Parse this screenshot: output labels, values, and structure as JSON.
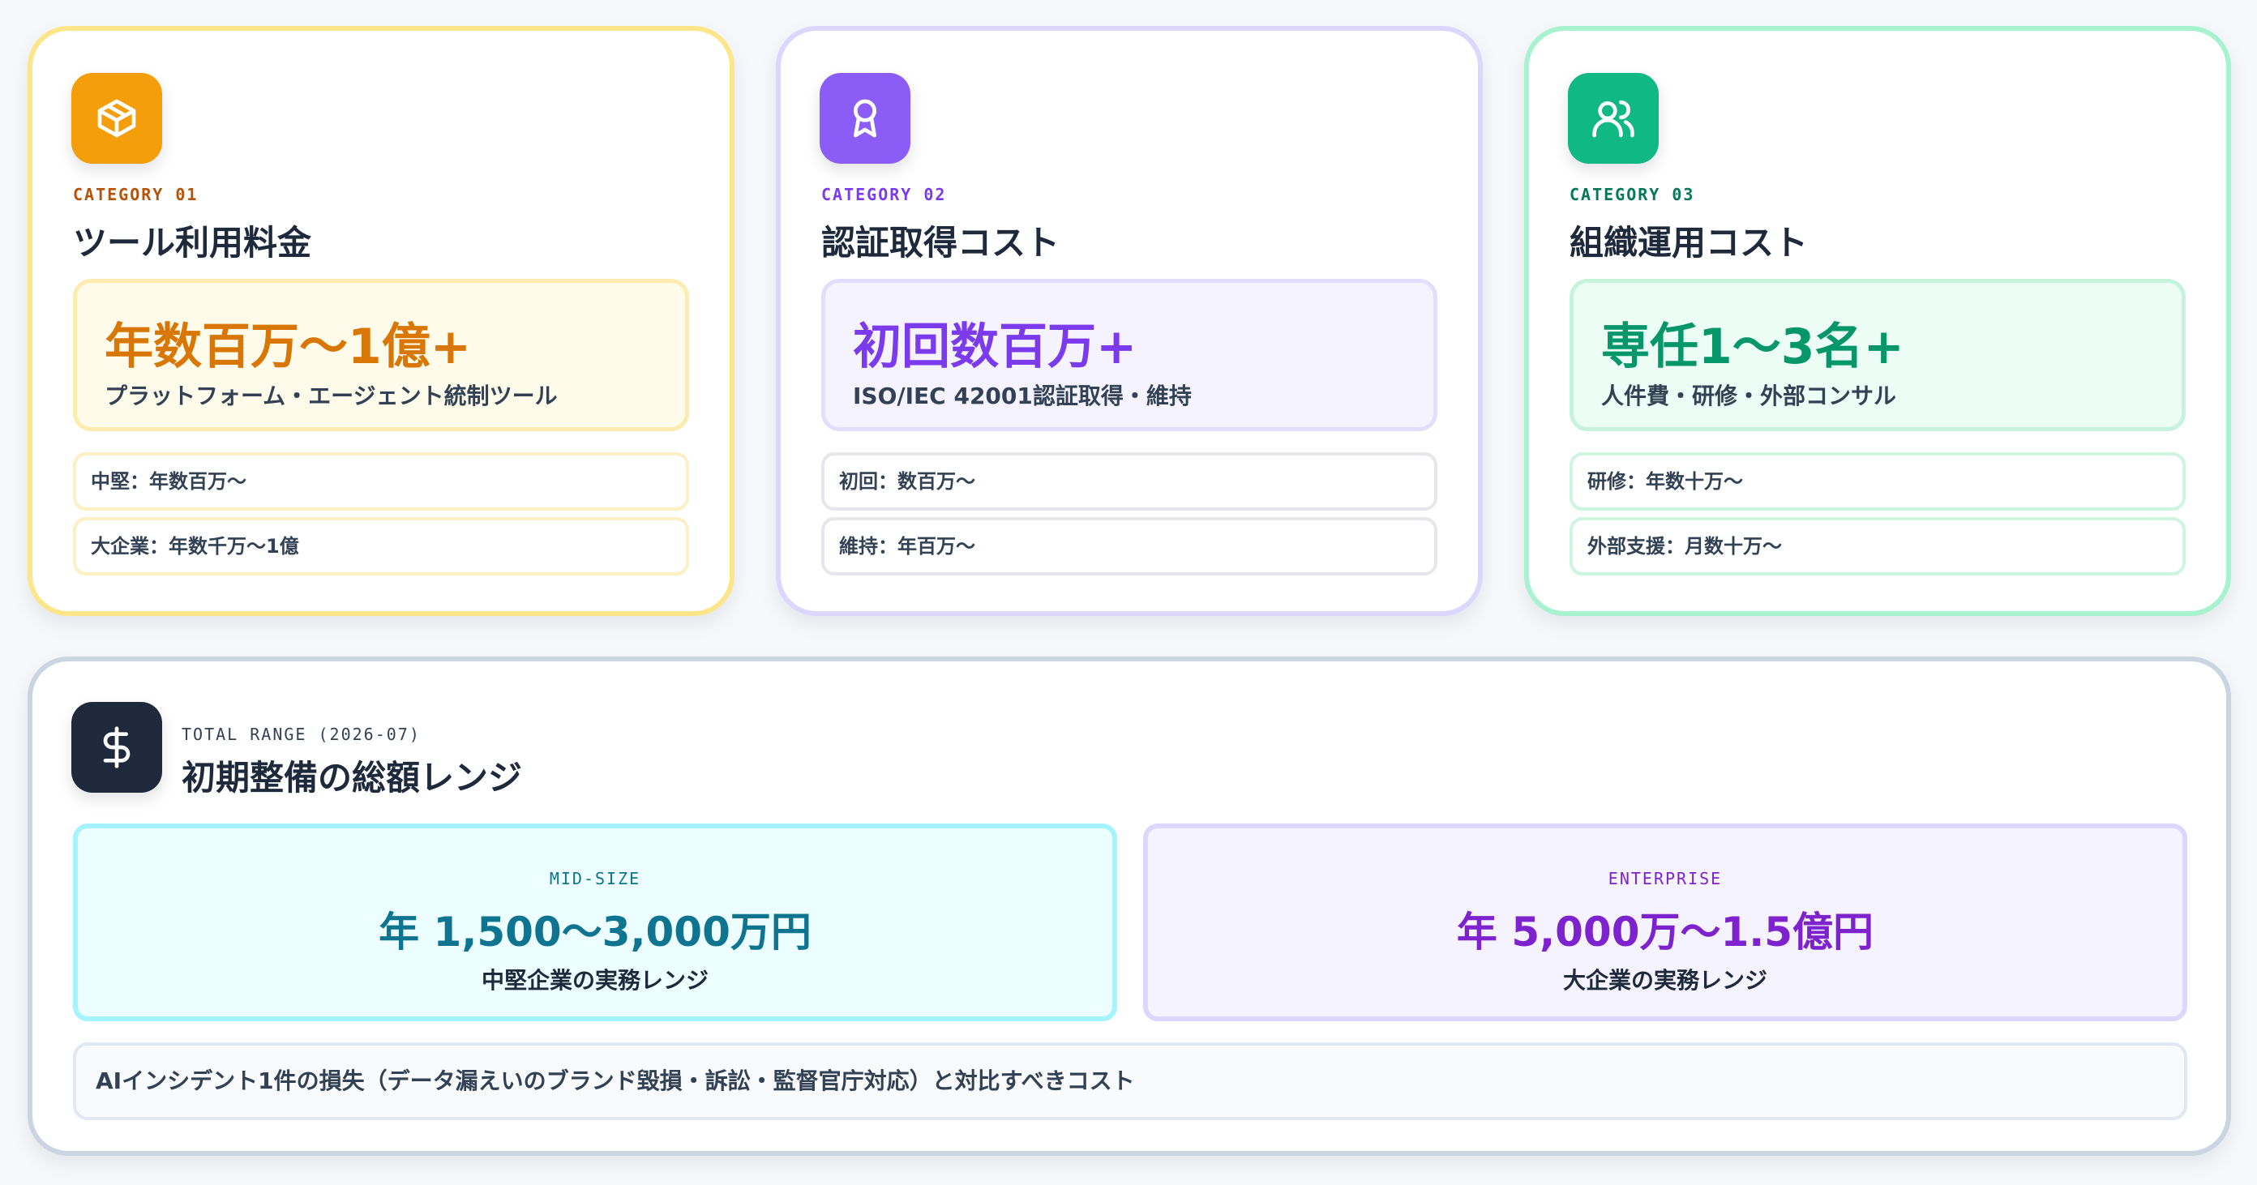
{
  "cards": [
    {
      "icon": "package-icon",
      "category": "CATEGORY 01",
      "title": "ツール利用料金",
      "value": "年数百万〜1億+",
      "subtitle": "プラットフォーム・エージェント統制ツール",
      "rows": [
        "中堅：年数百万〜",
        "大企業：年数千万〜1億"
      ],
      "accent": "#f59e0b"
    },
    {
      "icon": "award-icon",
      "category": "CATEGORY 02",
      "title": "認証取得コスト",
      "value": "初回数百万+",
      "subtitle": "ISO/IEC 42001認証取得・維持",
      "rows": [
        "初回：数百万〜",
        "維持：年百万〜"
      ],
      "accent": "#8b5cf6"
    },
    {
      "icon": "users-icon",
      "category": "CATEGORY 03",
      "title": "組織運用コスト",
      "value": "専任1〜3名+",
      "subtitle": "人件費・研修・外部コンサル",
      "rows": [
        "研修：年数十万〜",
        "外部支援：月数十万〜"
      ],
      "accent": "#10b981"
    }
  ],
  "total": {
    "icon": "dollar-icon",
    "label": "TOTAL RANGE (2026-07)",
    "title": "初期整備の総額レンジ",
    "ranges": [
      {
        "tag": "MID-SIZE",
        "value": "年 1,500〜3,000万円",
        "subtitle": "中堅企業の実務レンジ",
        "accent": "#0e7490"
      },
      {
        "tag": "ENTERPRISE",
        "value": "年 5,000万〜1.5億円",
        "subtitle": "大企業の実務レンジ",
        "accent": "#7e22ce"
      }
    ],
    "note": "AIインシデント1件の損失（データ漏えいのブランド毀損・訴訟・監督官庁対応）と対比すべきコスト"
  }
}
